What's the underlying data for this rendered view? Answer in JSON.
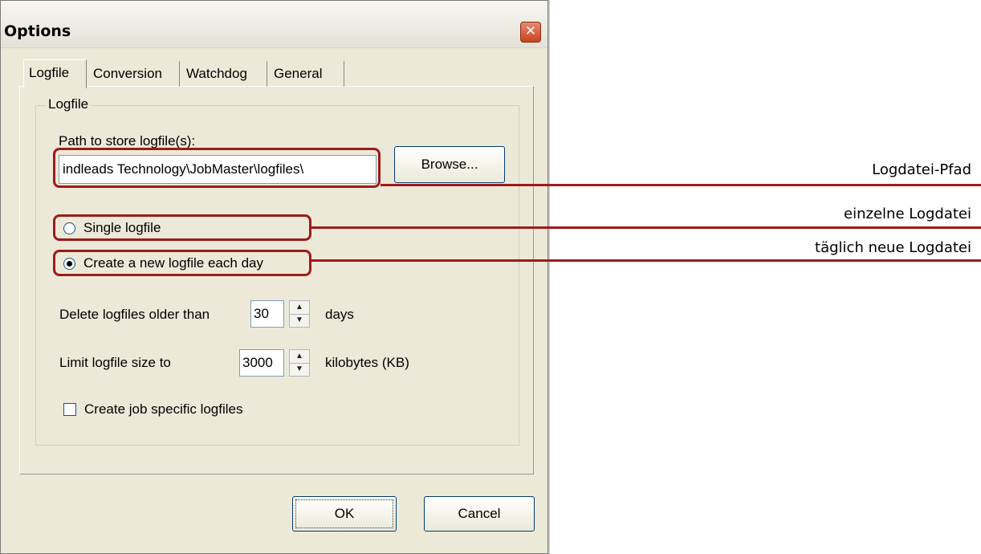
{
  "window": {
    "title": "Options",
    "close_glyph": "✕"
  },
  "tabs": [
    {
      "label": "Logfile",
      "active": true
    },
    {
      "label": "Conversion",
      "active": false
    },
    {
      "label": "Watchdog",
      "active": false
    },
    {
      "label": "General",
      "active": false
    }
  ],
  "group": {
    "label": "Logfile"
  },
  "path": {
    "label": "Path to store logfile(s):",
    "value": "indleads Technology\\JobMaster\\logfiles\\",
    "browse_label": "Browse..."
  },
  "radios": [
    {
      "label": "Single logfile",
      "selected": false
    },
    {
      "label": "Create a new logfile each day",
      "selected": true
    }
  ],
  "delete_older": {
    "label": "Delete logfiles older than",
    "value": "30",
    "unit": "days"
  },
  "limit_size": {
    "label": "Limit logfile size to",
    "value": "3000",
    "unit": "kilobytes (KB)"
  },
  "job_specific": {
    "label": "Create job specific logfiles",
    "checked": false
  },
  "buttons": {
    "ok": "OK",
    "cancel": "Cancel"
  },
  "annotations": {
    "path": "Logdatei-Pfad",
    "single": "einzelne Logdatei",
    "daily": "täglich neue Logdatei"
  },
  "colors": {
    "highlight": "#9e1b1b",
    "dialog_bg": "#ece9d8"
  }
}
